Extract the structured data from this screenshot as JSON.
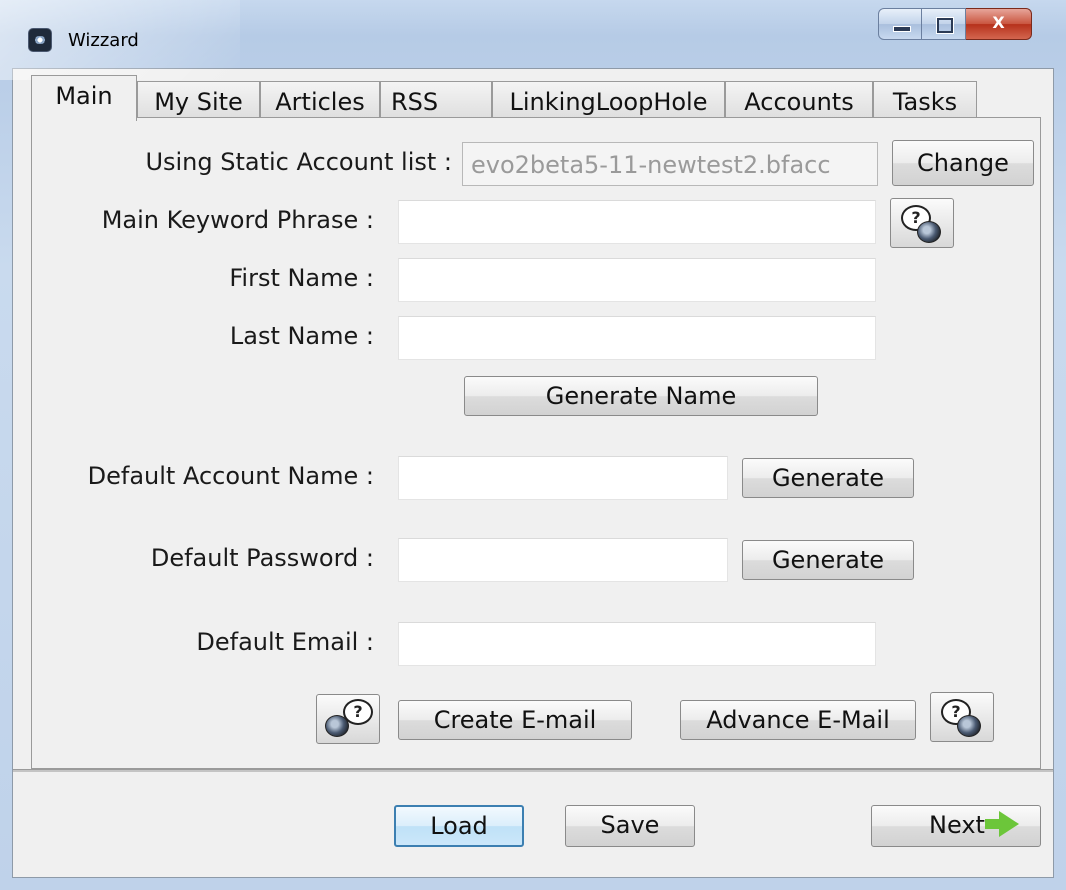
{
  "window": {
    "title": "Wizzard",
    "caption_buttons": {
      "minimize": "",
      "maximize": "",
      "close": "X"
    }
  },
  "tabs": [
    {
      "label": "Main",
      "active": true
    },
    {
      "label": "My Site"
    },
    {
      "label": "Articles"
    },
    {
      "label": "RSS"
    },
    {
      "label": "LinkingLoopHole"
    },
    {
      "label": "Accounts"
    },
    {
      "label": "Tasks"
    }
  ],
  "form": {
    "static_account_label": "Using Static Account list :",
    "static_account_value": "evo2beta5-11-newtest2.bfacc",
    "change_button": "Change",
    "keyword_label": "Main Keyword Phrase :",
    "keyword_value": "",
    "first_name_label": "First Name :",
    "first_name_value": "",
    "last_name_label": "Last Name :",
    "last_name_value": "",
    "generate_name_button": "Generate Name",
    "account_name_label": "Default Account Name :",
    "account_name_value": "",
    "generate_account_button": "Generate",
    "password_label": "Default Password :",
    "password_value": "",
    "generate_password_button": "Generate",
    "email_label": "Default Email :",
    "email_value": "",
    "create_email_button": "Create E-mail",
    "advance_email_button": "Advance E-Mail"
  },
  "footer": {
    "load_button": "Load",
    "save_button": "Save",
    "next_button": "Next"
  },
  "icons": {
    "app": "wizard-eye-icon",
    "help": "help-question-icon",
    "next_arrow": "green-arrow-right-icon"
  },
  "colors": {
    "focus_border": "#3c7fb1",
    "close_button": "#c9553f",
    "next_arrow": "#6cc63a"
  }
}
